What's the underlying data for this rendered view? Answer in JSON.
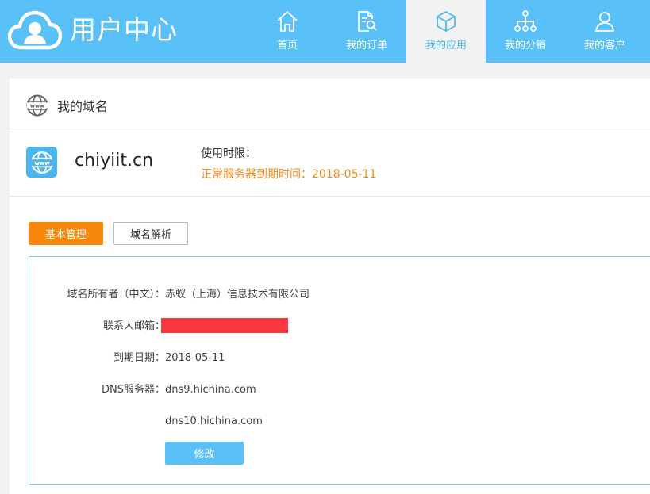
{
  "header": {
    "title": "用户中心",
    "nav": [
      {
        "label": "首页",
        "icon": "home-icon"
      },
      {
        "label": "我的订单",
        "icon": "order-search-icon"
      },
      {
        "label": "我的应用",
        "icon": "cube-icon"
      },
      {
        "label": "我的分销",
        "icon": "hierarchy-icon"
      },
      {
        "label": "我的客户",
        "icon": "user-icon"
      }
    ],
    "active_index": 2
  },
  "panel": {
    "title": "我的域名",
    "domain": "chiyiit.cn",
    "usage_label": "使用时限：",
    "usage_value": "正常服务器到期时间：2018-05-11"
  },
  "tabs": {
    "basic": "基本管理",
    "dns": "域名解析"
  },
  "info": {
    "owner_label": "域名所有者（中文）：",
    "owner_value": "赤蚁（上海）信息技术有限公司",
    "email_label": "联系人邮箱：",
    "expire_label": "到期日期：",
    "expire_value": "2018-05-11",
    "dns_label": "DNS服务器：",
    "dns_values": [
      "dns9.hichina.com",
      "dns10.hichina.com"
    ],
    "edit_label": "修改"
  },
  "colors": {
    "header_bg": "#5ac0f8",
    "accent_orange": "#f8870e",
    "expire_orange": "#f08c1c",
    "redaction": "#fb3640"
  }
}
